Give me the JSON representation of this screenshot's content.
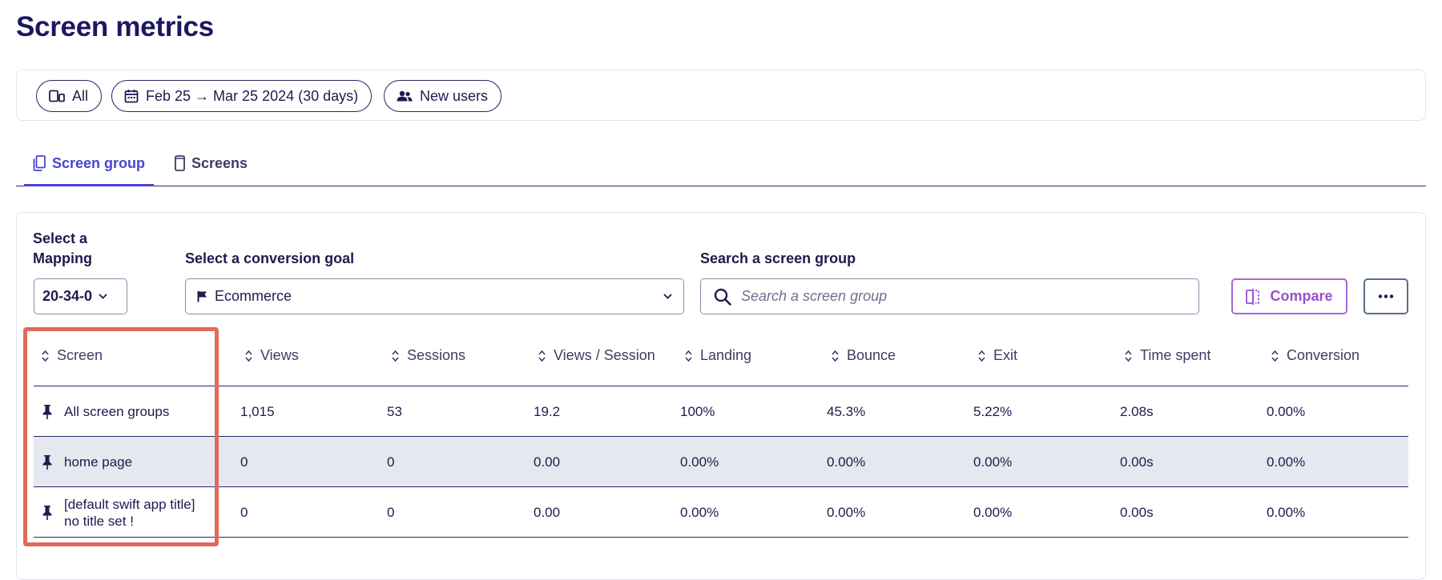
{
  "page": {
    "title": "Screen metrics"
  },
  "filters": {
    "device_label": "All",
    "date_range_label": "Feb 25 → Mar 25 2024 (30 days)",
    "segment_label": "New users"
  },
  "tabs": [
    {
      "label": "Screen group",
      "active": true
    },
    {
      "label": "Screens",
      "active": false
    }
  ],
  "controls": {
    "mapping_label": "Select a Mapping",
    "mapping_value": "20-34-0",
    "goal_label": "Select a conversion goal",
    "goal_value": "Ecommerce",
    "search_label": "Search a screen group",
    "search_placeholder": "Search a screen group",
    "compare_label": "Compare"
  },
  "table": {
    "columns": [
      "Screen",
      "Views",
      "Sessions",
      "Views / Session",
      "Landing",
      "Bounce",
      "Exit",
      "Time spent",
      "Conversion"
    ],
    "rows": [
      {
        "screen": "All screen groups",
        "views": "1,015",
        "sessions": "53",
        "views_per_session": "19.2",
        "landing": "100%",
        "bounce": "45.3%",
        "exit": "5.22%",
        "time_spent": "2.08s",
        "conversion": "0.00%"
      },
      {
        "screen": "home page",
        "views": "0",
        "sessions": "0",
        "views_per_session": "0.00",
        "landing": "0.00%",
        "bounce": "0.00%",
        "exit": "0.00%",
        "time_spent": "0.00s",
        "conversion": "0.00%"
      },
      {
        "screen": "[default swift app title] no title set !",
        "views": "0",
        "sessions": "0",
        "views_per_session": "0.00",
        "landing": "0.00%",
        "bounce": "0.00%",
        "exit": "0.00%",
        "time_spent": "0.00s",
        "conversion": "0.00%"
      }
    ]
  },
  "colors": {
    "title": "#1c1760",
    "accent": "#4a43d6",
    "compare": "#9a4fd0",
    "highlight": "#e06a5b",
    "row_alt": "#e6e8ef"
  }
}
